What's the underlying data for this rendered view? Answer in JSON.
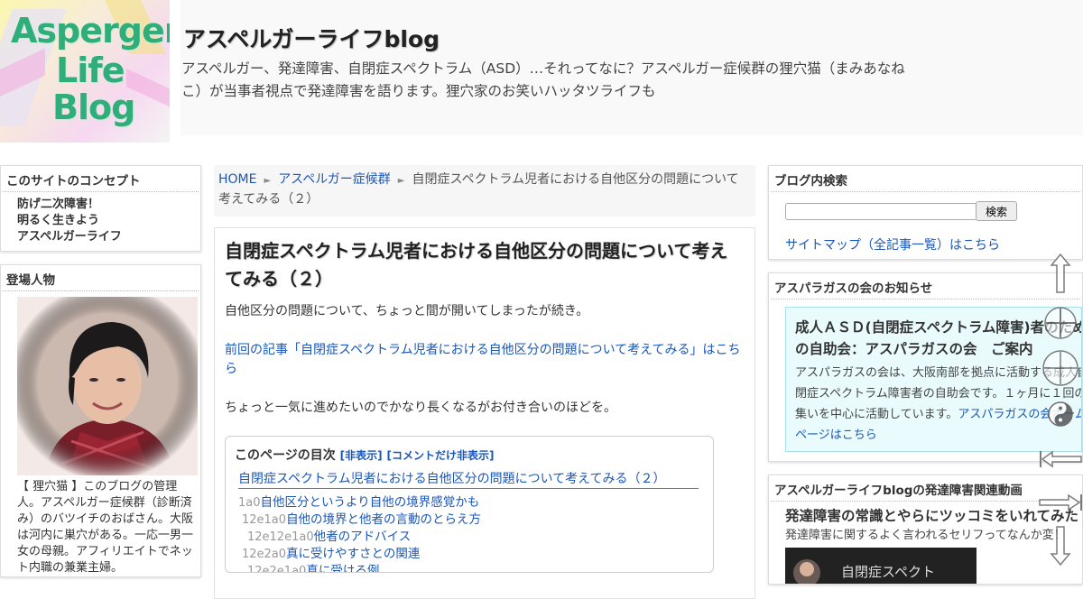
{
  "header": {
    "logo_lines": [
      "Asperger",
      "Life",
      "Blog"
    ],
    "site_title": "アスペルガーライフblog",
    "site_description": "アスペルガー、発達障害、自閉症スペクトラム（ASD）…それってなに？アスペルガー症候群の狸穴猫（まみあなねこ）が当事者視点で発達障害を語ります。狸穴家のお笑いハッタツライフも"
  },
  "sidebar_left": {
    "concept": {
      "title": "このサイトのコンセプト",
      "lines": [
        "防げ二次障害！",
        "明るく生きよう",
        "アスペルガーライフ"
      ]
    },
    "characters": {
      "title": "登場人物",
      "profile_text": "【 狸穴猫 】このブログの管理人。アスペルガー症候群（診断済み）のバツイチのおばさん。大阪は河内に巣穴がある。一応一男一女の母親。アフィリエイトでネット内職の兼業主婦。"
    }
  },
  "main": {
    "breadcrumb": {
      "home": "HOME",
      "category": "アスペルガー症候群",
      "current": "自閉症スペクトラム児者における自他区分の問題について考えてみる（２）",
      "separator": "►"
    },
    "article": {
      "title": "自閉症スペクトラム児者における自他区分の問題について考えてみる（２）",
      "paragraph1": "自他区分の問題について、ちょっと間が開いてしまったが続き。",
      "prev_link": "前回の記事「自閉症スペクトラム児者における自他区分の問題について考えてみる」はこちら",
      "paragraph2": "ちょっと一気に進めたいのでかなり長くなるがお付き合いのほどを。"
    },
    "toc": {
      "title": "このページの目次",
      "hide_label": "[非表示]",
      "comments_only_label": "[コメントだけ非表示]",
      "top_item": "自閉症スペクトラム児者における自他区分の問題について考えてみる（２）",
      "items": [
        {
          "num": "1a0",
          "label": "自他区分というより自他の境界感覚かも",
          "indent": 0
        },
        {
          "num": "12e1a0",
          "label": "自他の境界と他者の言動のとらえ方",
          "indent": 1
        },
        {
          "num": "12e12e1a0",
          "label": "他者のアドバイス",
          "indent": 2
        },
        {
          "num": "12e2a0",
          "label": "真に受けやすさとの関連",
          "indent": 1
        },
        {
          "num": "12e2e1a0",
          "label": "真に受ける例",
          "indent": 2
        }
      ]
    }
  },
  "sidebar_right": {
    "search": {
      "title": "ブログ内検索",
      "input_value": "",
      "button_label": "検索",
      "sitemap_link": "サイトマップ（全記事一覧）はこちら"
    },
    "notice": {
      "title": "アスパラガスの会のお知らせ",
      "heading_line1": "成人ＡＳＤ(自閉症スペクトラム障害)者のため",
      "heading_line2": "の自助会：アスパラガスの会　ご案内",
      "body_line1": "アスパラガスの会は、大阪南部を拠点に活動する成人自",
      "body_line2": "閉症スペクトラム障害者の自助会です。１ヶ月に１回の",
      "body_line3_text": "集いを中心に活動しています。",
      "body_line3_link": "アスパラガスの会ホーム",
      "body_line4_link": "ページはこちら"
    },
    "video": {
      "title": "アスペルガーライフblogの発達障害関連動画",
      "heading": "発達障害の常識とやらにツッコミをいれてみた",
      "sub": "発達障害に関するよく言われるセリフってなんか変！",
      "thumb_caption": "自閉症スペクト"
    }
  },
  "colors": {
    "link": "#1a57b8",
    "logo_green": "#2fae7a",
    "notice_bg": "#e9fbfd"
  }
}
